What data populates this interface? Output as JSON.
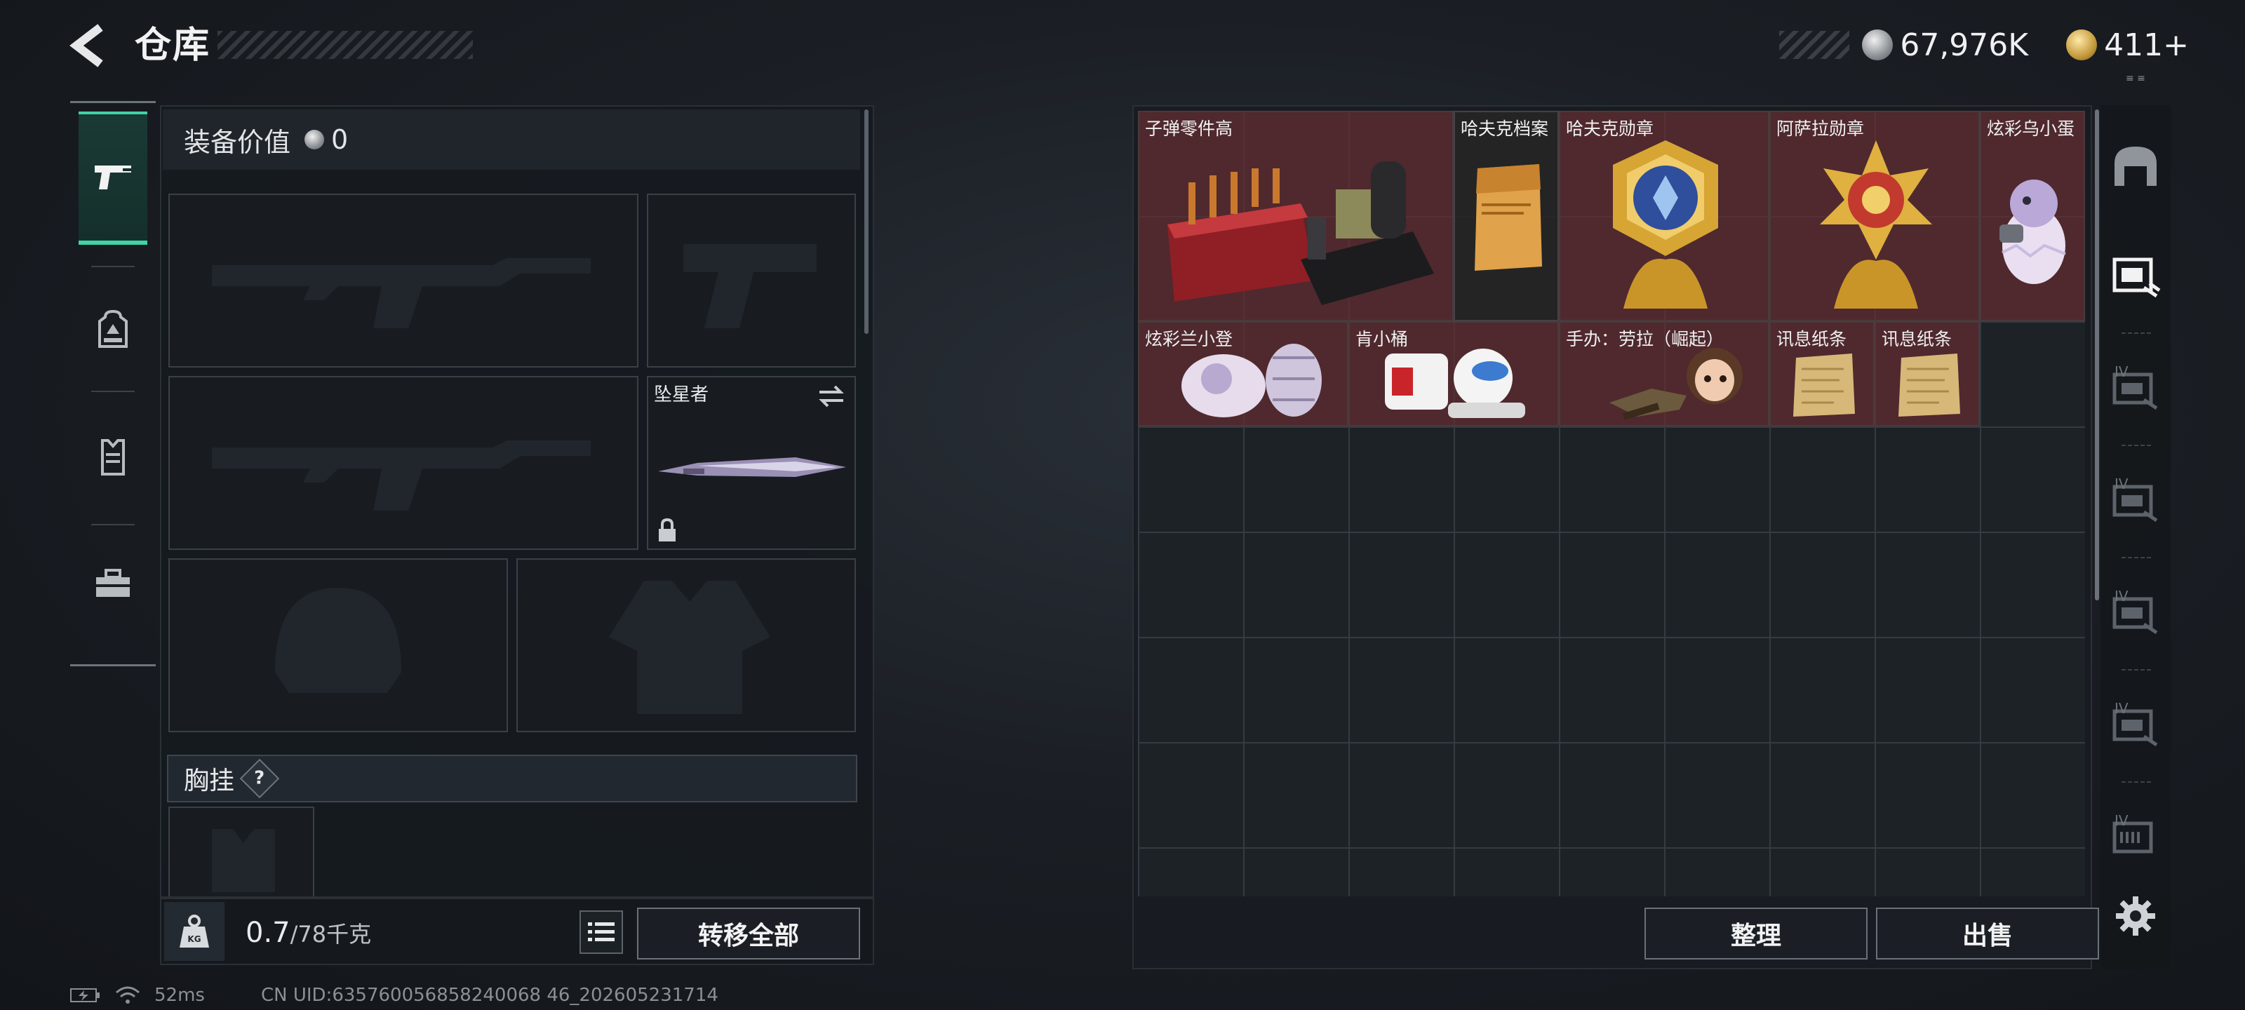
{
  "header": {
    "title": "仓库",
    "silver_amount": "67,976K",
    "gold_amount": "411+",
    "corner_mark": "≡ ≡"
  },
  "left_nav": {
    "items": [
      {
        "icon": "pistol-icon",
        "active": true
      },
      {
        "icon": "backpack-icon",
        "active": false
      },
      {
        "icon": "vest-icon",
        "active": false
      },
      {
        "icon": "toolbox-icon",
        "active": false
      }
    ]
  },
  "equipment": {
    "value_label": "装备价值",
    "value_amount": "0",
    "melee_slot_label": "坠星者",
    "chest_rig_label": "胸挂",
    "chest_help": "?",
    "weight_current": "0.7",
    "weight_max": "/78千克",
    "transfer_all_label": "转移全部"
  },
  "warehouse": {
    "items": [
      {
        "name": "子弹零件高",
        "rarity": "red"
      },
      {
        "name": "哈夫克档案",
        "rarity": "dark"
      },
      {
        "name": "哈夫克勋章",
        "rarity": "red"
      },
      {
        "name": "阿萨拉勋章",
        "rarity": "red"
      },
      {
        "name": "炫彩乌小蛋",
        "rarity": "red"
      },
      {
        "name": "炫彩兰小登",
        "rarity": "red"
      },
      {
        "name": "肯小桶",
        "rarity": "red"
      },
      {
        "name": "手办：劳拉（崛起）",
        "rarity": "red"
      },
      {
        "name": "讯息纸条",
        "rarity": "red"
      },
      {
        "name": "讯息纸条",
        "rarity": "red"
      }
    ],
    "sort_label": "整理",
    "sell_label": "出售"
  },
  "right_tabs": {
    "labels": [
      "",
      "",
      "IV",
      "IV",
      "IV",
      "IV",
      "IV"
    ]
  },
  "status": {
    "ping": "52ms",
    "uid": "CN UID:635760056858240068 46_202605231714"
  }
}
